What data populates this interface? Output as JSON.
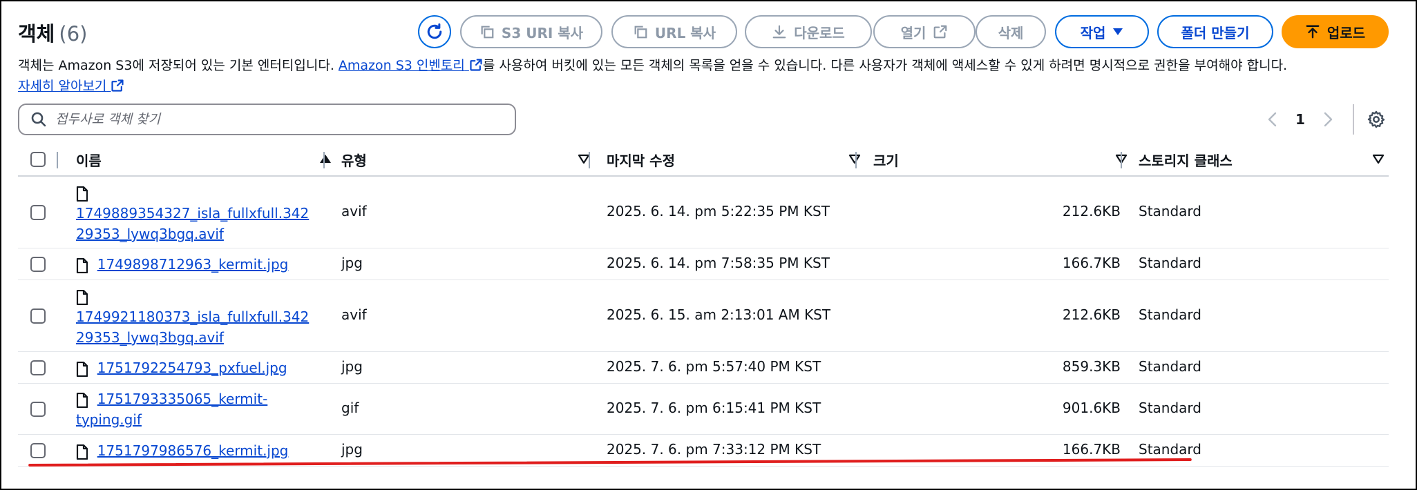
{
  "header": {
    "title": "객체",
    "count": "(6)",
    "buttons": {
      "s3_uri_copy": "S3 URI 복사",
      "url_copy": "URL 복사",
      "download": "다운로드",
      "open": "열기",
      "delete": "삭제",
      "actions": "작업",
      "create_folder": "폴더 만들기",
      "upload": "업로드"
    },
    "description_part1": "객체는 Amazon S3에 저장되어 있는 기본 엔터티입니다. ",
    "inventory_link": "Amazon S3 인벤토리",
    "description_part2": "를 사용하여 버킷에 있는 모든 객체의 목록을 얻을 수 있습니다. 다른 사용자가 객체에 액세스할 수 있게 하려면 명시적으로 권한을 부여해야 합니다.",
    "learn_more": "자세히 알아보기"
  },
  "search": {
    "placeholder": "접두사로 객체 찾기"
  },
  "pagination": {
    "current_page": "1"
  },
  "columns": {
    "name": "이름",
    "type": "유형",
    "modified": "마지막 수정",
    "size": "크기",
    "storage_class": "스토리지 클래스"
  },
  "rows": [
    {
      "name_l1": "1749889354327_isla_fullxfull.342",
      "name_l2": "29353_lywq3bgq.avif",
      "type": "avif",
      "modified": "2025. 6. 14. pm 5:22:35 PM KST",
      "size": "212.6KB",
      "storage_class": "Standard"
    },
    {
      "name_l1": "1749898712963_kermit.jpg",
      "name_l2": "",
      "type": "jpg",
      "modified": "2025. 6. 14. pm 7:58:35 PM KST",
      "size": "166.7KB",
      "storage_class": "Standard"
    },
    {
      "name_l1": "1749921180373_isla_fullxfull.342",
      "name_l2": "29353_lywq3bgq.avif",
      "type": "avif",
      "modified": "2025. 6. 15. am 2:13:01 AM KST",
      "size": "212.6KB",
      "storage_class": "Standard"
    },
    {
      "name_l1": "1751792254793_pxfuel.jpg",
      "name_l2": "",
      "type": "jpg",
      "modified": "2025. 7. 6. pm 5:57:40 PM KST",
      "size": "859.3KB",
      "storage_class": "Standard"
    },
    {
      "name_l1": "1751793335065_kermit-",
      "name_l2": "typing.gif",
      "type": "gif",
      "modified": "2025. 7. 6. pm 6:15:41 PM KST",
      "size": "901.6KB",
      "storage_class": "Standard"
    },
    {
      "name_l1": "1751797986576_kermit.jpg",
      "name_l2": "",
      "type": "jpg",
      "modified": "2025. 7. 6. pm 7:33:12 PM KST",
      "size": "166.7KB",
      "storage_class": "Standard"
    }
  ],
  "colors": {
    "link": "#0747d1",
    "primary": "#ff9900",
    "annotation": "#e01e1e"
  }
}
